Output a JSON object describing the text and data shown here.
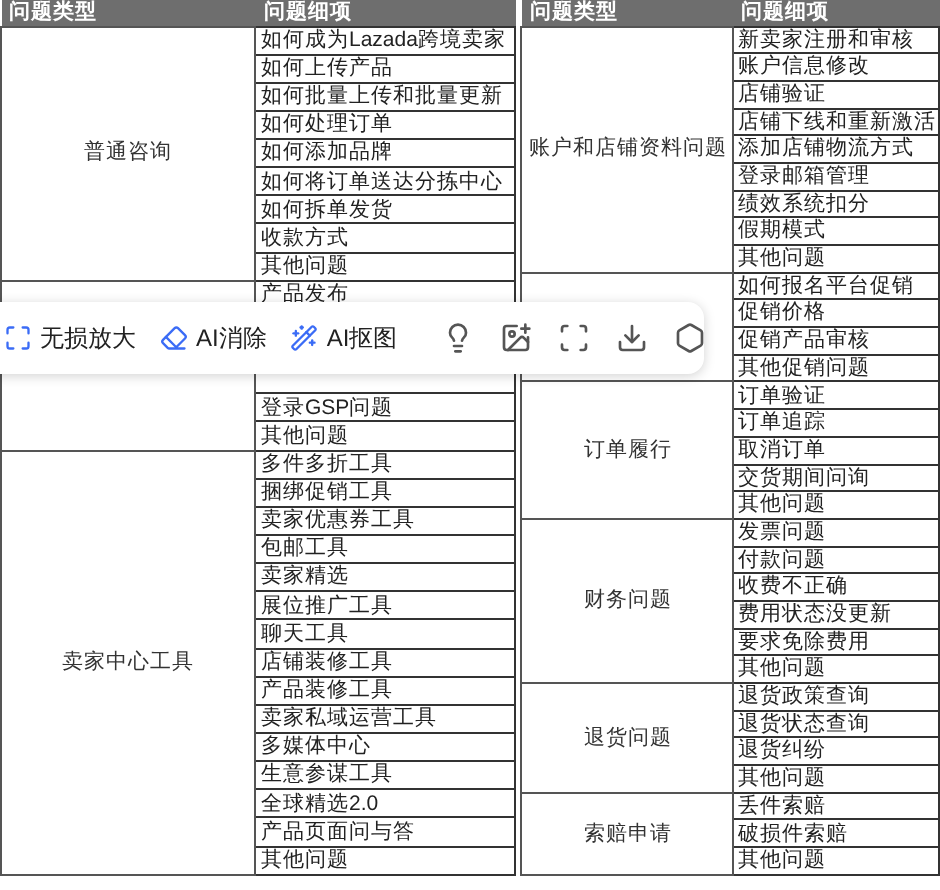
{
  "left_table": {
    "columns": [
      "问题类型",
      "问题细项"
    ],
    "groups": [
      {
        "type": "普通咨询",
        "details": [
          "如何成为Lazada跨境卖家",
          "如何上传产品",
          "如何批量上传和批量更新",
          "如何处理订单",
          "如何添加品牌",
          "如何将订单送达分拣中心",
          "如何拆单发货",
          "收款方式",
          "其他问题"
        ]
      },
      {
        "details": [
          "产品发布",
          {
            "kind": "covered"
          },
          {
            "kind": "covered"
          },
          {
            "kind": "covered"
          },
          "登录GSP问题",
          "其他问题"
        ]
      },
      {
        "type": "卖家中心工具",
        "details": [
          "多件多折工具",
          "捆绑促销工具",
          "卖家优惠券工具",
          "包邮工具",
          "卖家精选",
          "展位推广工具",
          "聊天工具",
          "店铺装修工具",
          "产品装修工具",
          "卖家私域运营工具",
          "多媒体中心",
          "生意参谋工具",
          "全球精选2.0",
          "产品页面问与答",
          "其他问题"
        ]
      }
    ]
  },
  "right_table": {
    "columns": [
      "问题类型",
      "问题细项"
    ],
    "groups": [
      {
        "type": "账户和店铺资料问题",
        "details": [
          "新卖家注册和审核",
          "账户信息修改",
          "店铺验证",
          "店铺下线和重新激活",
          "添加店铺物流方式",
          "登录邮箱管理",
          "绩效系统扣分",
          "假期模式",
          "其他问题"
        ]
      },
      {
        "details": [
          "如何报名平台促销",
          "促销价格",
          "促销产品审核",
          "其他促销问题"
        ]
      },
      {
        "type": "订单履行",
        "details": [
          "订单验证",
          "订单追踪",
          "取消订单",
          "交货期间问询",
          "其他问题"
        ]
      },
      {
        "type": "财务问题",
        "details": [
          "发票问题",
          "付款问题",
          "收费不正确",
          "费用状态没更新",
          "要求免除费用",
          "其他问题"
        ]
      },
      {
        "type": "退货问题",
        "details": [
          "退货政策查询",
          "退货状态查询",
          "退货纠纷",
          "其他问题"
        ]
      },
      {
        "type": "索赔申请",
        "details": [
          "丢件索赔",
          "破损件索赔",
          "其他问题"
        ]
      }
    ]
  },
  "toolbar": {
    "buttons": [
      {
        "kind": "upscale",
        "label": "无损放大"
      },
      {
        "kind": "erase",
        "label": "AI消除"
      },
      {
        "kind": "cutout",
        "label": "AI抠图"
      }
    ]
  }
}
